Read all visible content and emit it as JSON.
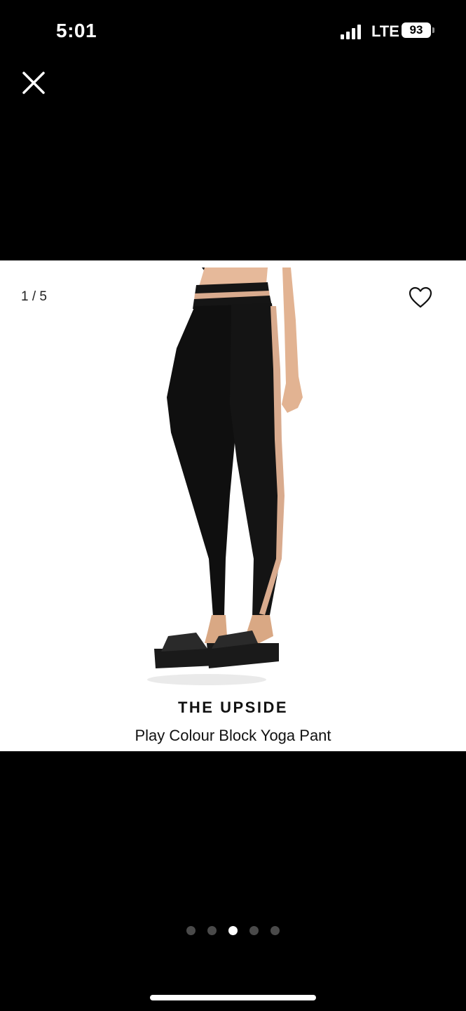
{
  "status_bar": {
    "time": "5:01",
    "network": "LTE",
    "battery": "93"
  },
  "icons": {
    "close": "close-icon",
    "favorite": "heart-outline-icon"
  },
  "gallery": {
    "counter": "1 / 5",
    "total_pages": 5,
    "active_page_index": 2
  },
  "product": {
    "brand": "THE UPSIDE",
    "name": "Play Colour Block Yoga Pant",
    "image_alt": "Black yoga pant with nude colour block side stripe"
  },
  "colors": {
    "background": "#000000",
    "card": "#ffffff",
    "dot_inactive": "#4a4a4a",
    "dot_active": "#ffffff",
    "stripe": "#d9ab8e"
  }
}
